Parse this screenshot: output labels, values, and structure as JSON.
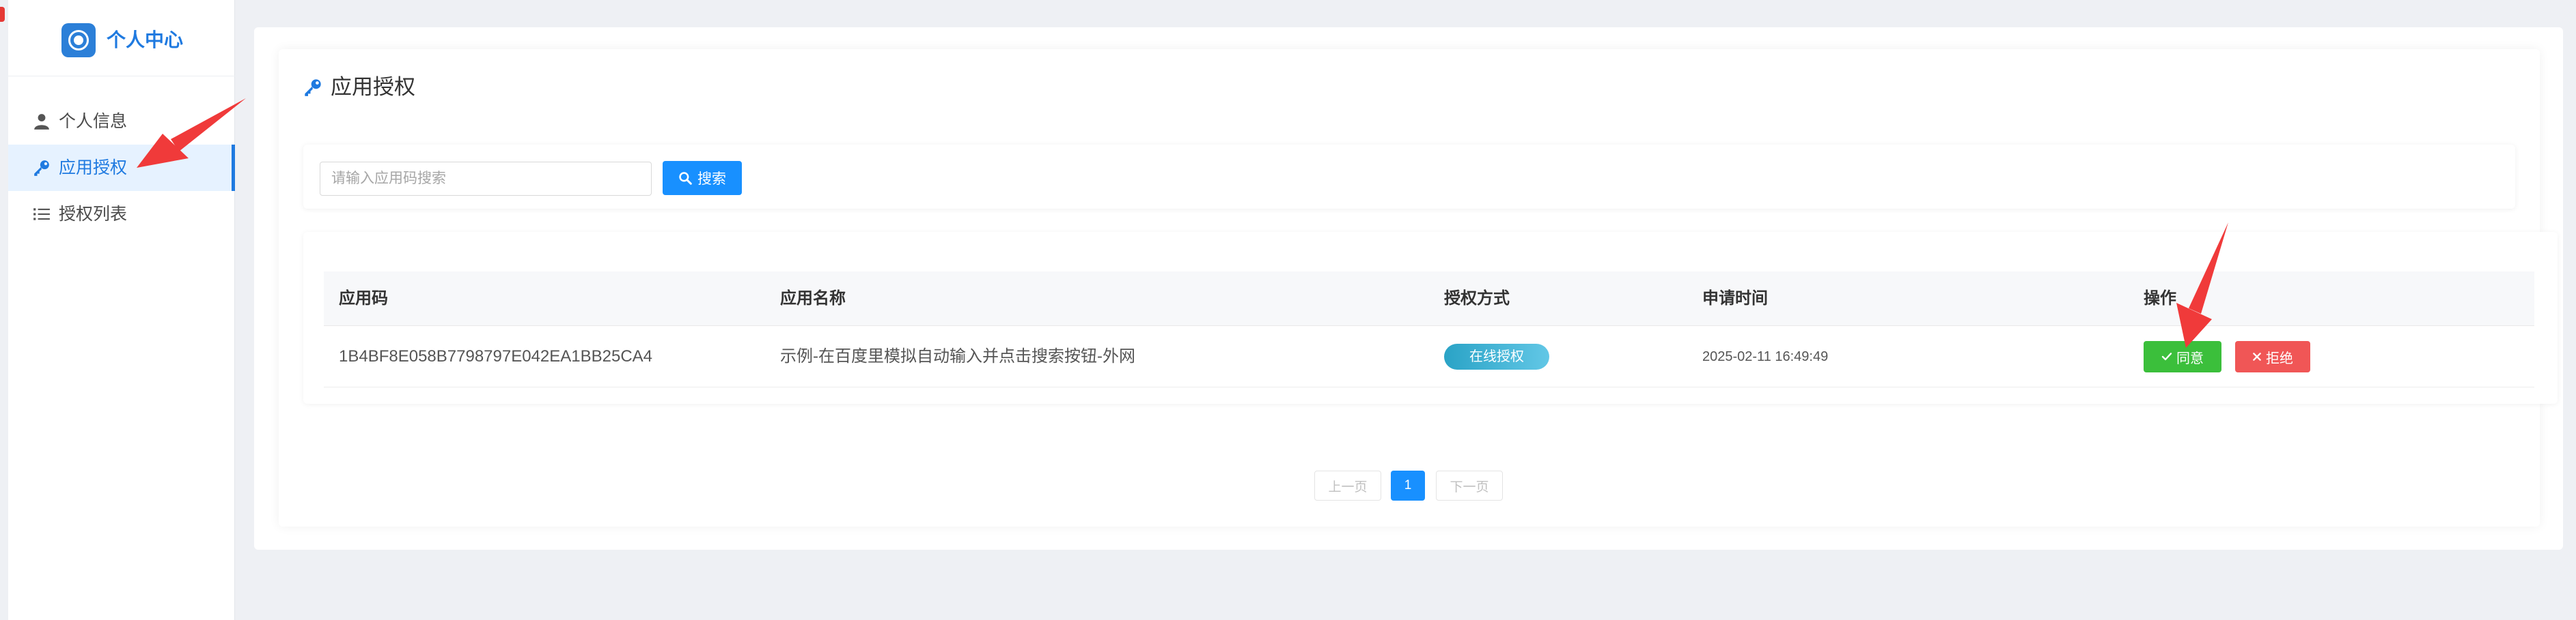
{
  "sidebar": {
    "brand_title": "个人中心",
    "items": [
      {
        "label": "个人信息",
        "icon": "user-icon",
        "active": false
      },
      {
        "label": "应用授权",
        "icon": "key-icon",
        "active": true
      },
      {
        "label": "授权列表",
        "icon": "list-icon",
        "active": false
      }
    ]
  },
  "page": {
    "title": "应用授权",
    "title_icon": "key-icon"
  },
  "search": {
    "placeholder": "请输入应用码搜索",
    "value": "",
    "button_label": "搜索",
    "button_icon": "search-icon"
  },
  "table": {
    "columns": [
      "应用码",
      "应用名称",
      "授权方式",
      "申请时间",
      "操作"
    ],
    "rows": [
      {
        "app_code": "1B4BF8E058B7798797E042EA1BB25CA4",
        "app_name": "示例-在百度里模拟自动输入并点击搜索按钮-外网",
        "auth_method": "在线授权",
        "apply_time": "2025-02-11 16:49:49",
        "actions": {
          "agree": "同意",
          "reject": "拒绝"
        }
      }
    ]
  },
  "pagination": {
    "prev_label": "上一页",
    "current_page": "1",
    "next_label": "下一页"
  },
  "colors": {
    "accent": "#1890ff",
    "brand": "#1f7ae0",
    "agree": "#3bbf3b",
    "reject": "#f05656",
    "annotation_arrow": "#f03a3a"
  }
}
